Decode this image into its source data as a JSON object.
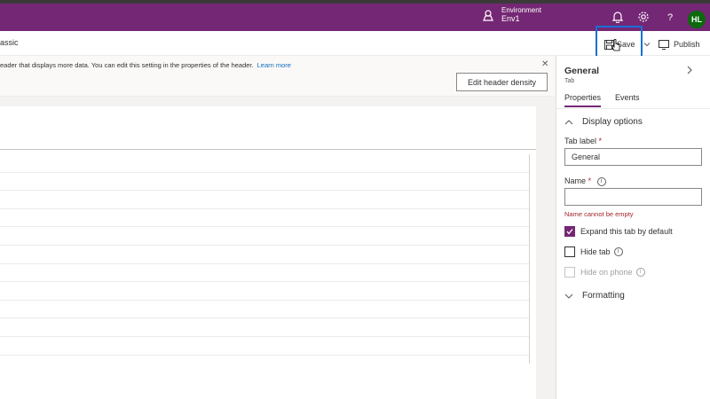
{
  "topbar": {
    "environment_label": "Environment",
    "environment_name": "Env1",
    "avatar_initials": "HL",
    "color": "#742774"
  },
  "commandbar": {
    "left_text": "assic",
    "save_label": "Save",
    "publish_label": "Publish"
  },
  "infobar": {
    "message": "eader that displays more data. You can edit this setting in the properties of the header.",
    "learn_more": "Learn more",
    "edit_header_density": "Edit header density"
  },
  "panel": {
    "title": "General",
    "subtitle": "Tab",
    "tabs": [
      {
        "label": "Properties",
        "active": true
      },
      {
        "label": "Events",
        "active": false
      }
    ],
    "display_options_label": "Display options",
    "tab_label_field": {
      "label": "Tab label",
      "required_mark": "*",
      "value": "General"
    },
    "name_field": {
      "label": "Name",
      "required_mark": "*",
      "value": "",
      "error": "Name cannot be empty"
    },
    "checkboxes": [
      {
        "label": "Expand this tab by default",
        "checked": true,
        "disabled": false
      },
      {
        "label": "Hide tab",
        "checked": false,
        "disabled": false
      },
      {
        "label": "Hide on phone",
        "checked": false,
        "disabled": true
      }
    ],
    "formatting_label": "Formatting"
  }
}
